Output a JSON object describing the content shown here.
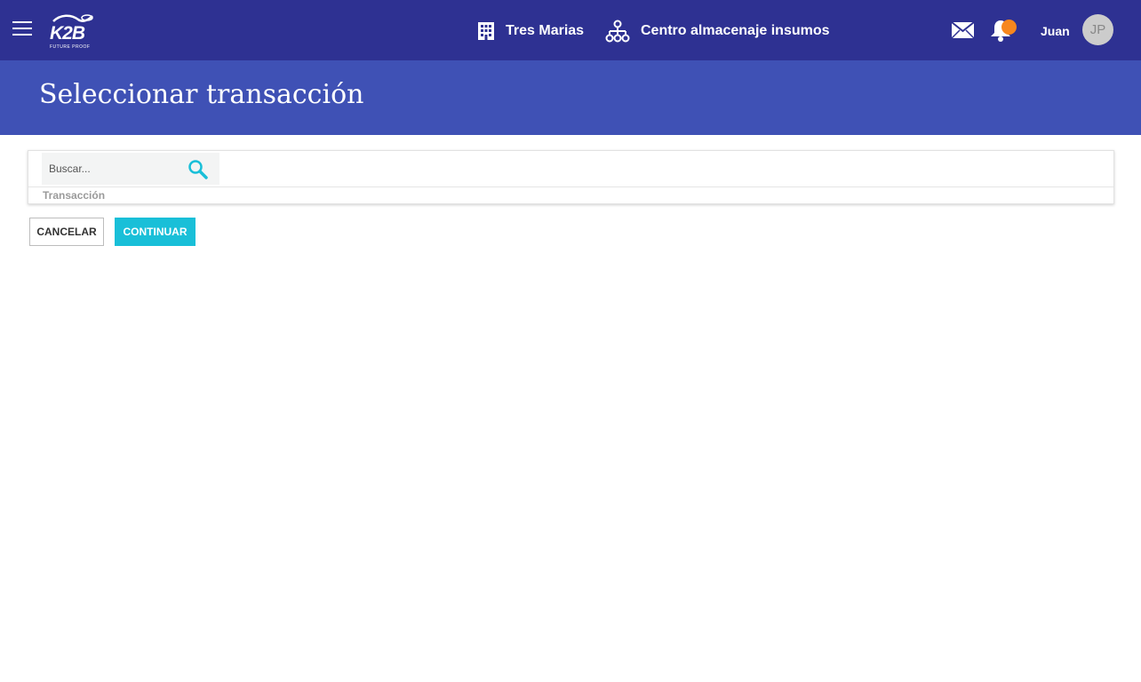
{
  "header": {
    "logo_text": "K2B",
    "logo_tagline": "FUTURE PROOF",
    "company": "Tres Marias",
    "company_icon": "building-icon",
    "unit": "Centro almacenaje insumos",
    "unit_icon": "org-chart-icon",
    "mail_icon": "envelope-icon",
    "notification_icon": "bell-icon",
    "notification_dot_color": "#f7871e",
    "user_name": "Juan",
    "user_initials": "JP"
  },
  "page": {
    "title": "Seleccionar transacción"
  },
  "search": {
    "placeholder": "Buscar...",
    "value": ""
  },
  "grid": {
    "columns": [
      "Transacción"
    ],
    "rows": []
  },
  "actions": {
    "cancel_label": "CANCELAR",
    "continue_label": "CONTINUAR"
  },
  "colors": {
    "topbar": "#2e3192",
    "titlebar": "#3f51b5",
    "accent": "#19bfd8"
  }
}
